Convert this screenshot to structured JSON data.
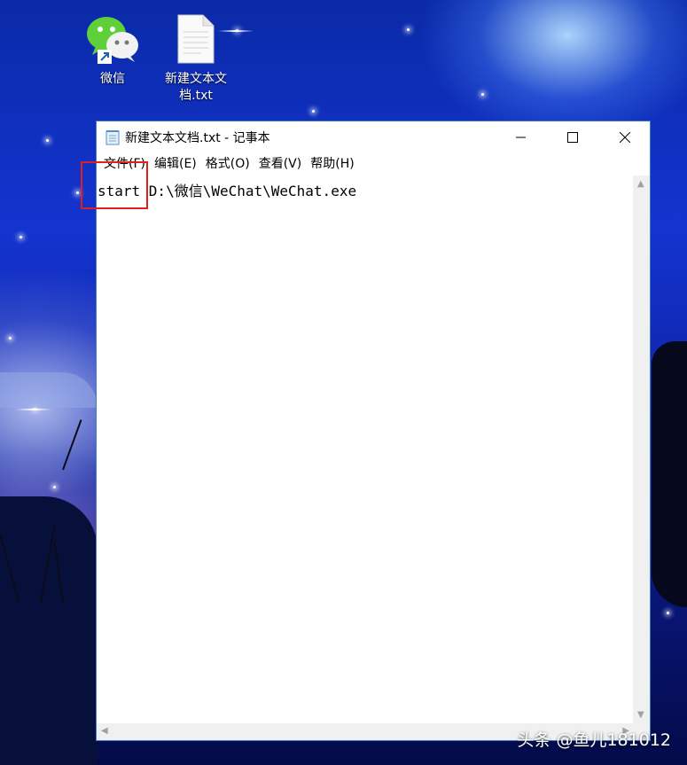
{
  "desktop": {
    "icons": [
      {
        "label": "微信",
        "icon": "wechat-icon"
      },
      {
        "label": "新建文本文档.txt",
        "icon": "text-file-icon"
      }
    ]
  },
  "notepad": {
    "title": "新建文本文档.txt - 记事本",
    "menu": [
      "文件(F)",
      "编辑(E)",
      "格式(O)",
      "查看(V)",
      "帮助(H)"
    ],
    "content": "start D:\\微信\\WeChat\\WeChat.exe",
    "controls": {
      "minimize": "minimize-icon",
      "maximize": "maximize-icon",
      "close": "close-icon"
    }
  },
  "colors": {
    "annotation_box": "#e02020",
    "window_border": "#3c78c8"
  },
  "watermark": "头条 @鱼儿181012"
}
